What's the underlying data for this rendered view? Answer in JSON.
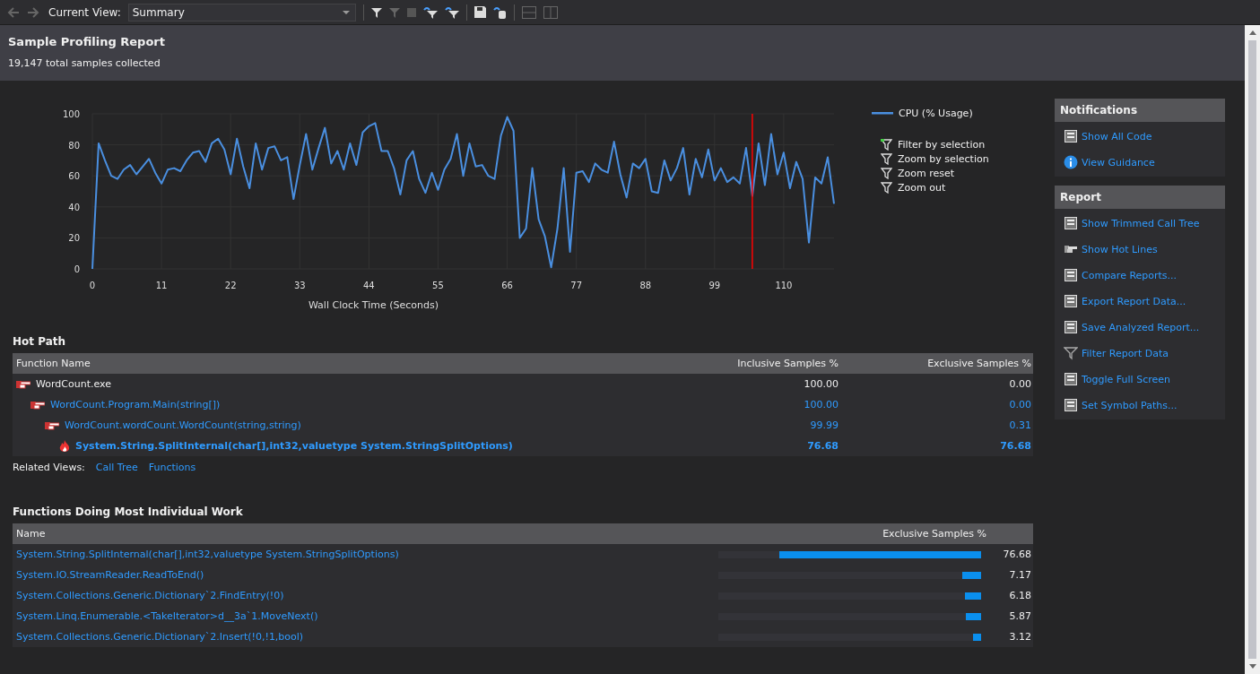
{
  "toolbar": {
    "view_label": "Current View:",
    "view_value": "Summary"
  },
  "header": {
    "title": "Sample Profiling Report",
    "subtitle": "19,147 total samples collected"
  },
  "chart": {
    "actions": [
      "Filter by selection",
      "Zoom by selection",
      "Zoom reset",
      "Zoom out"
    ],
    "chart_data": {
      "type": "line",
      "xlabel": "Wall Clock Time (Seconds)",
      "xlim": [
        0,
        118
      ],
      "ylim": [
        0,
        100
      ],
      "xticks": [
        0,
        11,
        22,
        33,
        44,
        55,
        66,
        77,
        88,
        99,
        110
      ],
      "yticks": [
        0,
        20,
        40,
        60,
        80,
        100
      ],
      "x": [
        0,
        1,
        2,
        3,
        4,
        5,
        6,
        7,
        8,
        9,
        10,
        11,
        12,
        13,
        14,
        15,
        16,
        17,
        18,
        19,
        20,
        21,
        22,
        23,
        24,
        25,
        26,
        27,
        28,
        29,
        30,
        31,
        32,
        33,
        34,
        35,
        36,
        37,
        38,
        39,
        40,
        41,
        42,
        43,
        44,
        45,
        46,
        47,
        48,
        49,
        50,
        51,
        52,
        53,
        54,
        55,
        56,
        57,
        58,
        59,
        60,
        61,
        62,
        63,
        64,
        65,
        66,
        67,
        68,
        69,
        70,
        71,
        72,
        73,
        74,
        75,
        76,
        77,
        78,
        79,
        80,
        81,
        82,
        83,
        84,
        85,
        86,
        87,
        88,
        89,
        90,
        91,
        92,
        93,
        94,
        95,
        96,
        97,
        98,
        99,
        100,
        101,
        102,
        103,
        104,
        105,
        106,
        107,
        108,
        109,
        110,
        111,
        112,
        113,
        114,
        115,
        116,
        117,
        118
      ],
      "series": [
        {
          "name": "CPU (% Usage)",
          "color": "#4a8fe0",
          "values": [
            0,
            81,
            70,
            60,
            58,
            64,
            67,
            61,
            66,
            71,
            62,
            55,
            64,
            65,
            63,
            70,
            75,
            76,
            69,
            81,
            84,
            77,
            61,
            84,
            66,
            52,
            81,
            64,
            78,
            79,
            70,
            72,
            45,
            67,
            87,
            64,
            78,
            91,
            68,
            76,
            64,
            81,
            67,
            88,
            92,
            94,
            76,
            76,
            65,
            48,
            70,
            76,
            58,
            49,
            62,
            51,
            64,
            71,
            87,
            60,
            81,
            66,
            67,
            60,
            58,
            86,
            98,
            89,
            20,
            26,
            65,
            32,
            21,
            1,
            26,
            65,
            11,
            62,
            63,
            56,
            68,
            64,
            62,
            82,
            61,
            46,
            68,
            65,
            71,
            50,
            49,
            70,
            57,
            65,
            78,
            48,
            71,
            59,
            77,
            57,
            65,
            56,
            59,
            55,
            78,
            47,
            81,
            54,
            87,
            61,
            75,
            52,
            69,
            58,
            17,
            59,
            55,
            72,
            42
          ]
        }
      ],
      "grid": true,
      "ref_lines": [
        {
          "axis": "x",
          "value": 105
        }
      ]
    }
  },
  "hot_path": {
    "title": "Hot Path",
    "columns": [
      "Function Name",
      "Inclusive Samples %",
      "Exclusive Samples %"
    ],
    "tree": [
      {
        "kind": "root",
        "name": "WordCount.exe",
        "inclusive": "100.00",
        "exclusive": "0.00",
        "children": [
          {
            "kind": "call",
            "name": "WordCount.Program.Main(string[])",
            "inclusive": "100.00",
            "exclusive": "0.00",
            "children": [
              {
                "kind": "call",
                "name": "WordCount.wordCount.WordCount(string,string)",
                "inclusive": "99.99",
                "exclusive": "0.31",
                "children": [
                  {
                    "kind": "hot",
                    "name": "System.String.SplitInternal(char[],int32,valuetype System.StringSplitOptions)",
                    "inclusive": "76.68",
                    "exclusive": "76.68"
                  }
                ]
              }
            ]
          }
        ]
      }
    ],
    "related_label": "Related Views:",
    "related_links": [
      "Call Tree",
      "Functions"
    ]
  },
  "functions": {
    "title": "Functions Doing Most Individual Work",
    "columns": [
      "Name",
      "Exclusive Samples %"
    ],
    "rows": [
      {
        "name": "System.String.SplitInternal(char[],int32,valuetype System.StringSplitOptions)",
        "value": "76.68",
        "level": 0.7668
      },
      {
        "name": "System.IO.StreamReader.ReadToEnd()",
        "value": "7.17",
        "level": 0.0717
      },
      {
        "name": "System.Collections.Generic.Dictionary`2.FindEntry(!0)",
        "value": "6.18",
        "level": 0.0618
      },
      {
        "name": "System.Linq.Enumerable.<TakeIterator>d__3a`1.MoveNext()",
        "value": "5.87",
        "level": 0.0587
      },
      {
        "name": "System.Collections.Generic.Dictionary`2.Insert(!0,!1,bool)",
        "value": "3.12",
        "level": 0.0312
      }
    ]
  },
  "sidebar": [
    {
      "title": "Notifications",
      "items": [
        "Show All Code",
        "View Guidance"
      ]
    },
    {
      "title": "Report",
      "items": [
        "Show Trimmed Call Tree",
        "Show Hot Lines",
        "Compare Reports...",
        "Export Report Data...",
        "Save Analyzed Report...",
        "Filter Report Data",
        "Toggle Full Screen",
        "Set Symbol Paths..."
      ]
    }
  ]
}
